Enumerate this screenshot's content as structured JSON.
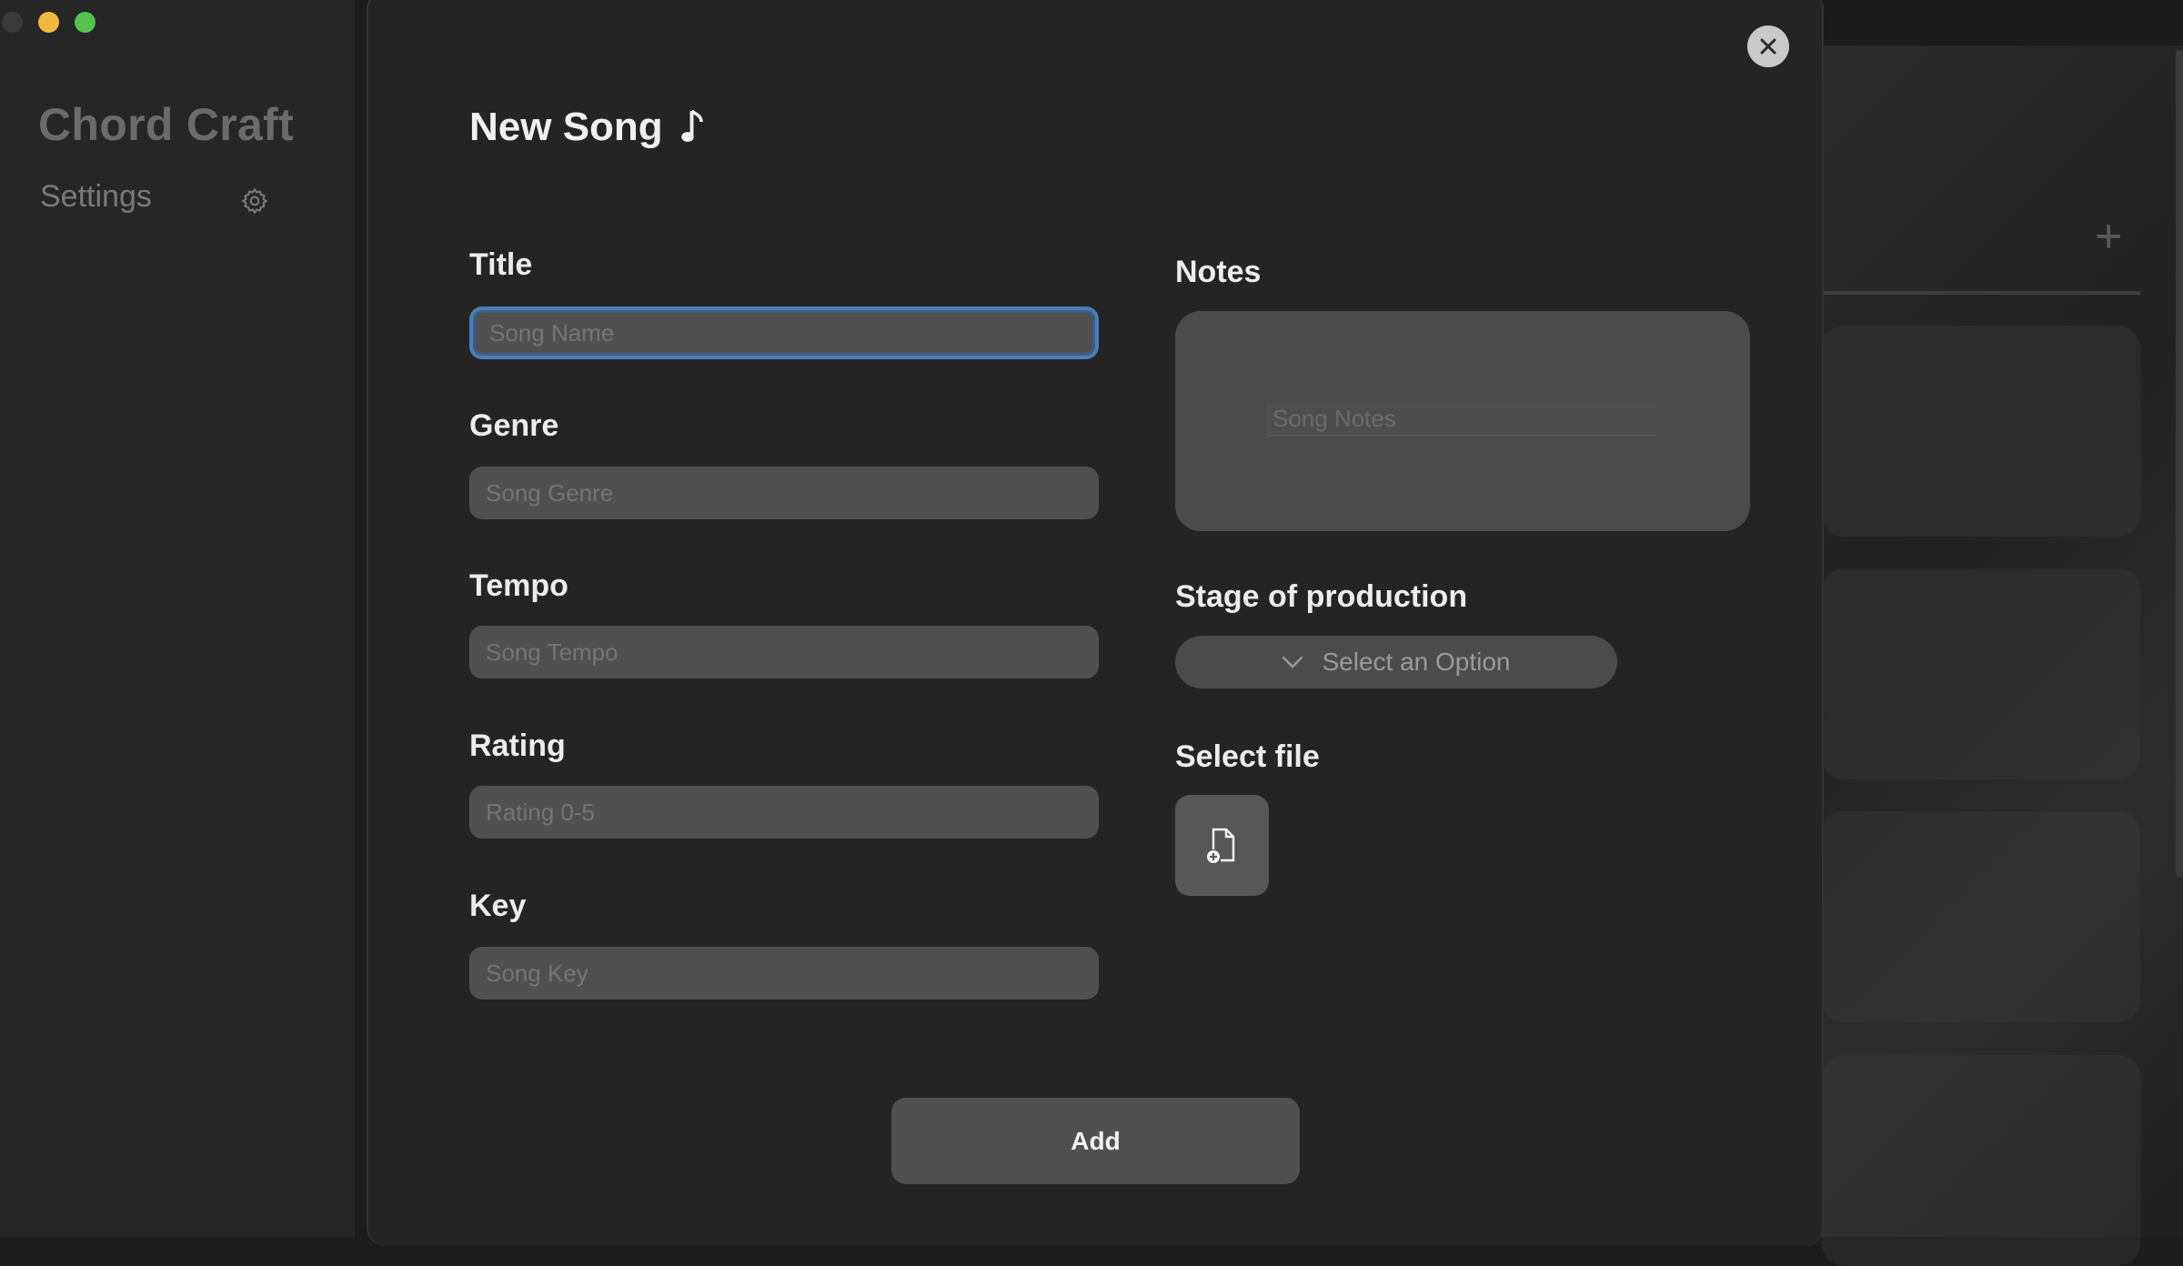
{
  "sidebar": {
    "app_title": "Chord Craft",
    "settings_label": "Settings"
  },
  "modal": {
    "title": "New Song",
    "fields": {
      "title": {
        "label": "Title",
        "placeholder": "Song Name",
        "value": ""
      },
      "genre": {
        "label": "Genre",
        "placeholder": "Song Genre",
        "value": ""
      },
      "tempo": {
        "label": "Tempo",
        "placeholder": "Song Tempo",
        "value": ""
      },
      "rating": {
        "label": "Rating",
        "placeholder": "Rating 0-5",
        "value": ""
      },
      "key": {
        "label": "Key",
        "placeholder": "Song Key",
        "value": ""
      },
      "notes": {
        "label": "Notes",
        "placeholder": "Song Notes",
        "value": ""
      }
    },
    "stage": {
      "label": "Stage of production",
      "selected": "Select an Option"
    },
    "file": {
      "label": "Select file"
    },
    "add_label": "Add"
  },
  "colors": {
    "focus_ring": "#4a7fb5",
    "traffic_min": "#f3b83e",
    "traffic_max": "#55c252"
  },
  "icons": [
    "gear-icon",
    "music-note-icon",
    "close-icon",
    "chevron-down-icon",
    "file-add-icon",
    "plus-icon"
  ]
}
